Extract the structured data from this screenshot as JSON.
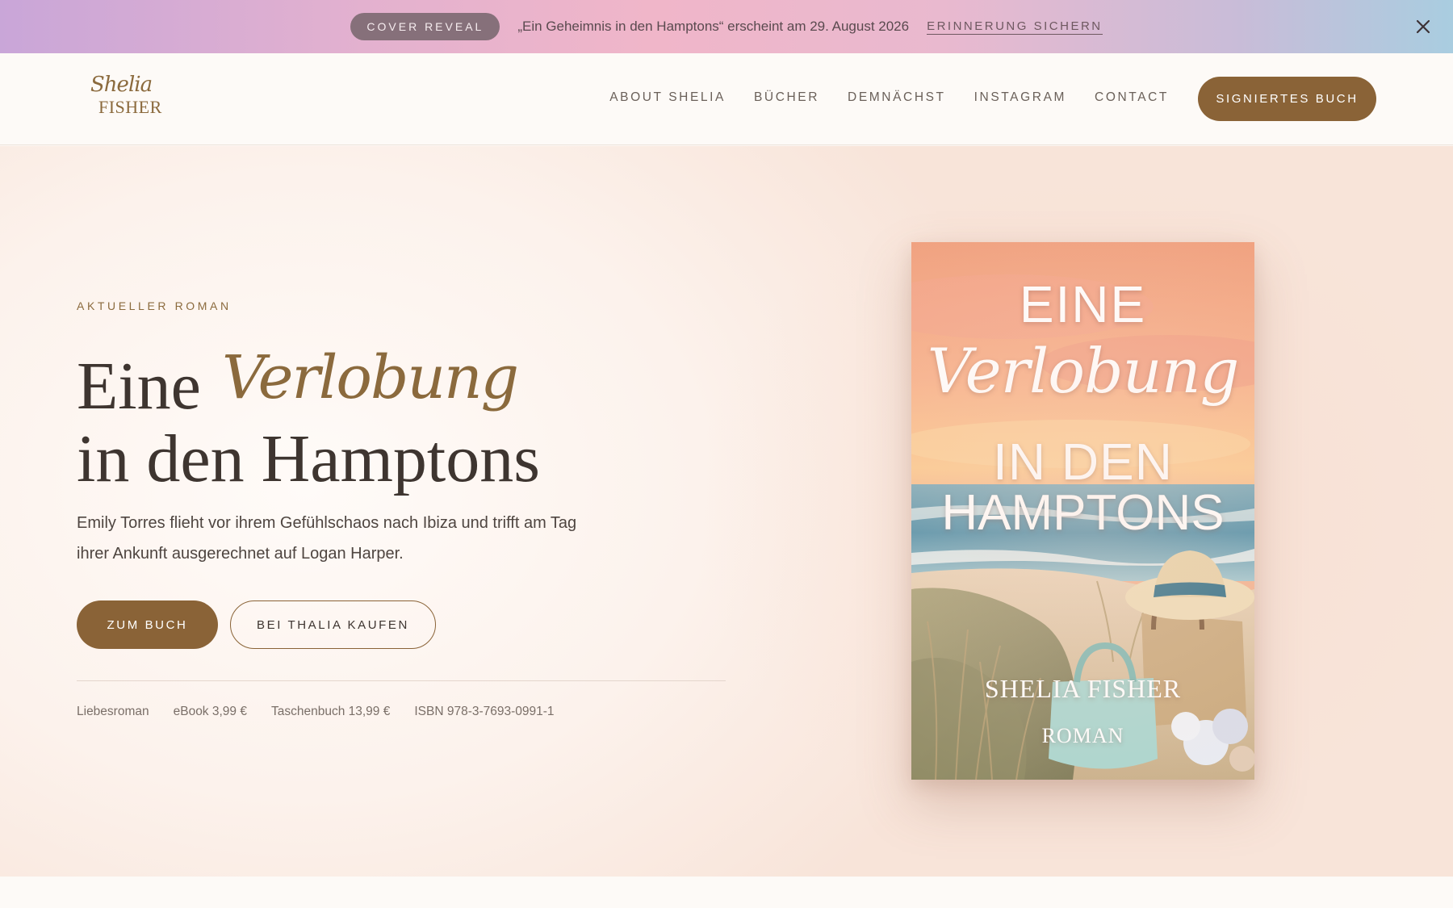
{
  "announcement": {
    "badge": "COVER REVEAL",
    "text": "„Ein Geheimnis in den Hamptons“ erscheint am 29. August 2026",
    "link": "ERINNERUNG SICHERN",
    "close_icon": "close-icon"
  },
  "header": {
    "logo_script": "Shelia",
    "logo_caps": "FISHER",
    "nav": [
      {
        "label": "ABOUT SHELIA"
      },
      {
        "label": "BÜCHER"
      },
      {
        "label": "DEMNÄCHST"
      },
      {
        "label": "INSTAGRAM"
      },
      {
        "label": "CONTACT"
      }
    ],
    "cta": "SIGNIERTES BUCH"
  },
  "hero": {
    "eyebrow": "AKTUELLER ROMAN",
    "title_serif": "Eine",
    "title_script": "Verlobung",
    "title_line2": "in den Hamptons",
    "description": "Emily Torres flieht vor ihrem Gefühlschaos nach Ibiza und trifft am Tag ihrer Ankunft ausgerechnet auf Logan Harper.",
    "primary_button": "ZUM BUCH",
    "secondary_button": "BEI THALIA KAUFEN",
    "meta": [
      "Liebesroman",
      "eBook 3,99 €",
      "Taschenbuch 13,99 €",
      "ISBN 978-3-7693-0991-1"
    ]
  },
  "cover": {
    "line1": "EINE",
    "script": "Verlobung",
    "line3": "IN DEN",
    "line4": "HAMPTONS",
    "author": "SHELIA FISHER",
    "genre": "ROMAN"
  },
  "colors": {
    "accent": "#8a6337",
    "text": "#3e3530",
    "background": "#fdf8f4"
  }
}
